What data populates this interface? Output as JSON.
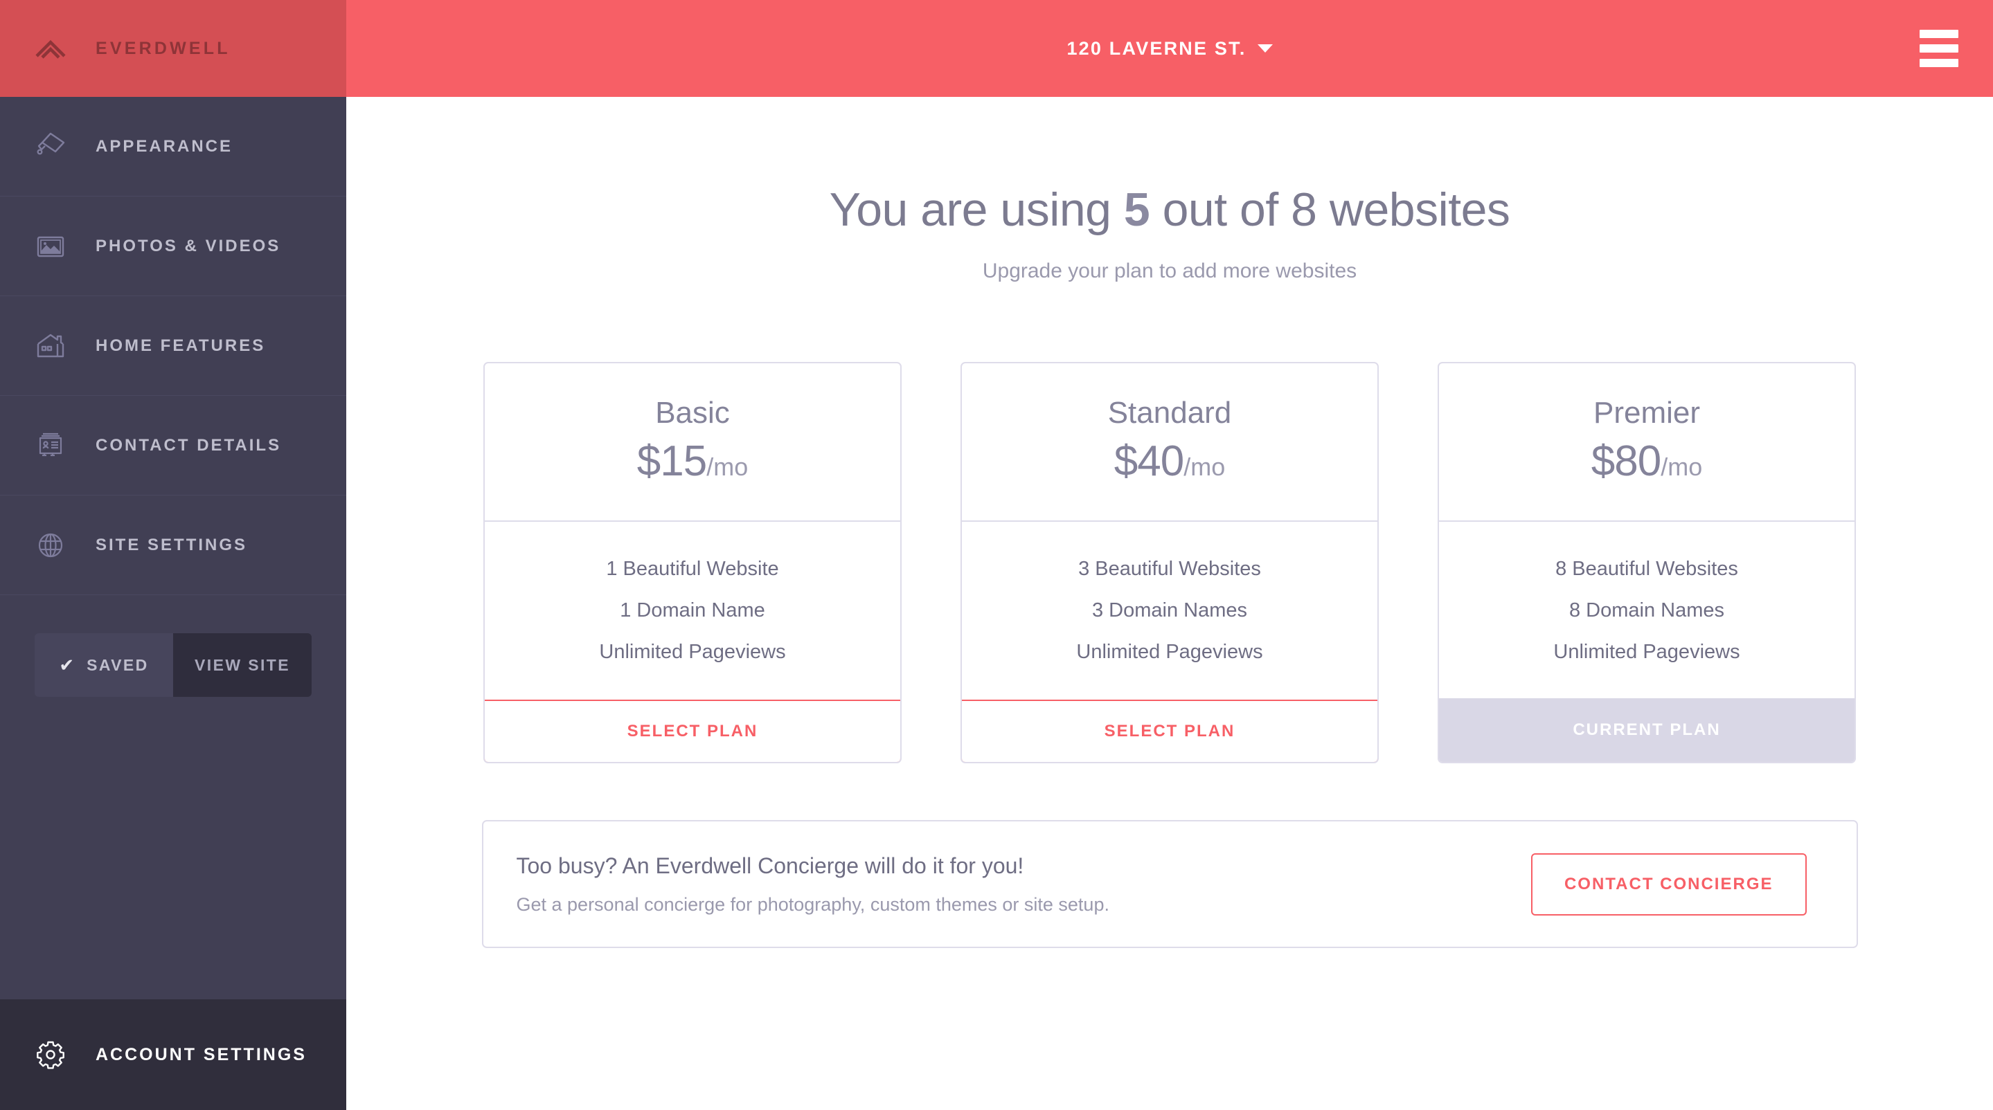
{
  "brand": {
    "name": "EVERDWELL",
    "logo_icon": "chevron-up-mark"
  },
  "sidebar": {
    "items": [
      {
        "label": "APPEARANCE",
        "icon": "paint-roller-icon"
      },
      {
        "label": "PHOTOS & VIDEOS",
        "icon": "photo-frame-icon"
      },
      {
        "label": "HOME FEATURES",
        "icon": "house-icon"
      },
      {
        "label": "CONTACT DETAILS",
        "icon": "contact-card-icon"
      },
      {
        "label": "SITE SETTINGS",
        "icon": "globe-icon"
      }
    ],
    "saved_label": "SAVED",
    "saved_check": "✔",
    "view_site_label": "VIEW SITE",
    "account_settings_label": "ACCOUNT SETTINGS",
    "account_settings_icon": "gear-icon"
  },
  "topbar": {
    "address": "120 LAVERNE ST.",
    "caret_icon": "chevron-down-icon",
    "menu_icon": "hamburger-menu-icon"
  },
  "usage": {
    "prefix": "You are using",
    "count": "5",
    "suffix": "out of 8 websites",
    "used": 5,
    "total": 8,
    "subhead": "Upgrade your plan to add more websites"
  },
  "plans": [
    {
      "name": "Basic",
      "amount": "$15",
      "per": "/mo",
      "features": [
        "1 Beautiful Website",
        "1 Domain Name",
        "Unlimited Pageviews"
      ],
      "cta_label": "SELECT PLAN",
      "cta_state": "select"
    },
    {
      "name": "Standard",
      "amount": "$40",
      "per": "/mo",
      "features": [
        "3 Beautiful Websites",
        "3 Domain Names",
        "Unlimited Pageviews"
      ],
      "cta_label": "SELECT PLAN",
      "cta_state": "select"
    },
    {
      "name": "Premier",
      "amount": "$80",
      "per": "/mo",
      "features": [
        "8 Beautiful Websites",
        "8 Domain Names",
        "Unlimited Pageviews"
      ],
      "cta_label": "CURRENT PLAN",
      "cta_state": "current"
    }
  ],
  "concierge": {
    "title": "Too busy? An Everdwell Concierge will do it for you!",
    "subtitle": "Get a personal concierge for photography, custom themes or site setup.",
    "button_label": "CONTACT CONCIERGE"
  },
  "colors": {
    "accent_red": "#F75F66",
    "logo_red": "#D44F54",
    "sidebar": "#413F54",
    "sidebar_footer": "#302E3C",
    "card_border": "#DEDCEA",
    "current_plan_bg": "#D9D7E6"
  }
}
